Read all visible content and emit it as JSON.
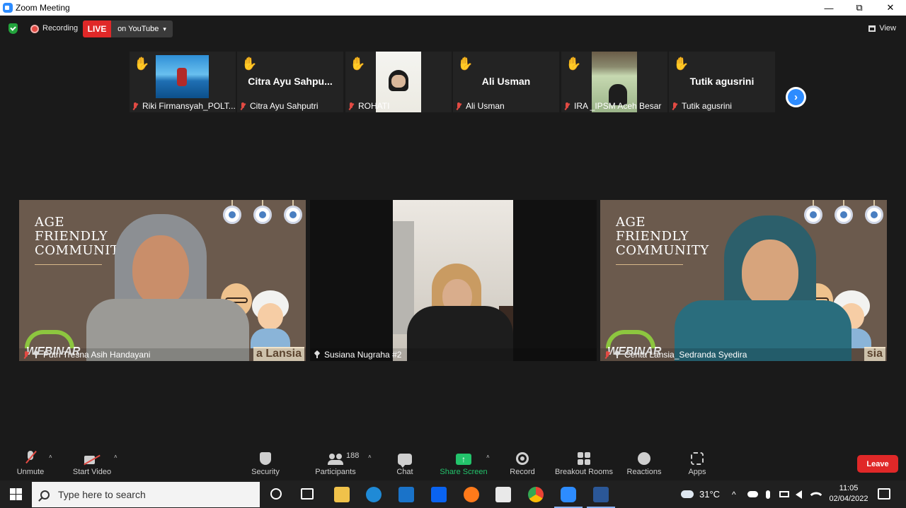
{
  "window": {
    "title": "Zoom Meeting",
    "controls": {
      "minimize": "—",
      "restore": "⧉",
      "close": "✕"
    }
  },
  "topbar": {
    "recording_label": "Recording",
    "live_label": "LIVE",
    "youtube_label": "on YouTube",
    "youtube_caret": "▾",
    "view_label": "View"
  },
  "thumbnails": [
    {
      "caption": "Riki Firmansyah_POLT...",
      "big_name": "",
      "has_photo": "beach",
      "hand": "✋"
    },
    {
      "caption": "Citra Ayu Sahputri",
      "big_name": "Citra  Ayu  Sahpu...",
      "hand": "✋"
    },
    {
      "caption": "ROHATI",
      "big_name": "",
      "has_photo": "rohati",
      "hand": "✋"
    },
    {
      "caption": "Ali Usman",
      "big_name": "Ali Usman",
      "hand": "✋"
    },
    {
      "caption": "IRA _IPSM Aceh Besar",
      "big_name": "",
      "has_photo": "ira",
      "hand": "✋"
    },
    {
      "caption": "Tutik agusrini",
      "big_name": "Tutik agusrini",
      "hand": "✋"
    }
  ],
  "next_arrow": "›",
  "tiles": [
    {
      "caption": "Putri Tresna Asih Handayani",
      "bg_title_lines": [
        "AGE",
        "FRIENDLY",
        "COMMUNITY"
      ],
      "webinar": "WEBINAR",
      "lansia": "a Lansia"
    },
    {
      "caption": "Susiana Nugraha #2"
    },
    {
      "caption": "Cerita Lansia_Sedranda Syedira",
      "bg_title_lines": [
        "AGE",
        "FRIENDLY",
        "COMMUNITY"
      ],
      "webinar": "WEBINAR",
      "lansia": "sia"
    }
  ],
  "toolbar": {
    "unmute": "Unmute",
    "start_video": "Start Video",
    "security": "Security",
    "participants": "Participants",
    "participants_count": "188",
    "chat": "Chat",
    "share_screen": "Share Screen",
    "share_arrow": "↑",
    "record": "Record",
    "breakout_rooms": "Breakout Rooms",
    "reactions": "Reactions",
    "apps": "Apps",
    "leave": "Leave",
    "caret": "˄"
  },
  "taskbar": {
    "search_placeholder": "Type here to search",
    "weather": "31°C",
    "time": "11:05",
    "date": "02/04/2022",
    "tray_icons": [
      "chevron-up-icon",
      "cloud-icon",
      "microphone-icon",
      "battery-icon",
      "speaker-icon",
      "wifi-icon"
    ]
  },
  "colors": {
    "live_red": "#e02828",
    "share_green": "#23c36b",
    "zoom_blue": "#2d8cff",
    "hand_yellow": "#f2c02f",
    "muted_red": "#e24a43"
  }
}
